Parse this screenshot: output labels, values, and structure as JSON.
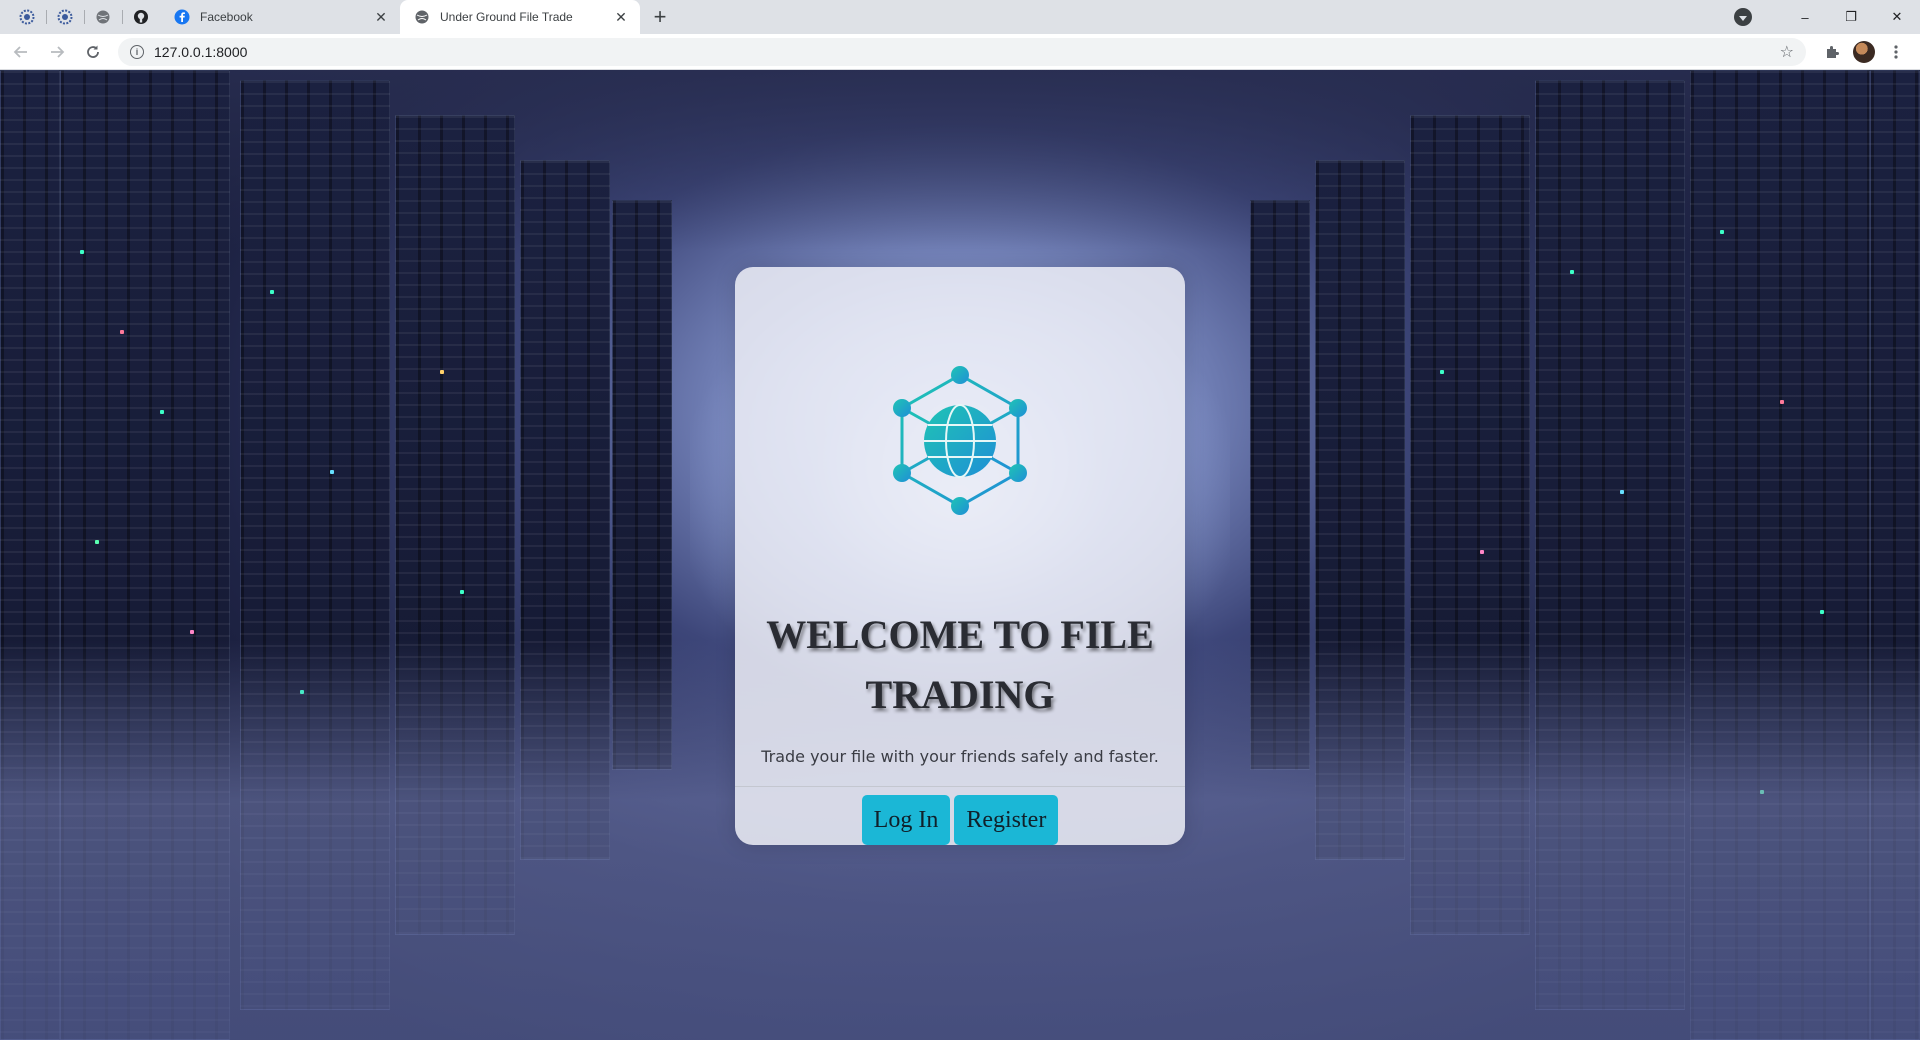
{
  "browser": {
    "tabs": [
      {
        "title": "Facebook",
        "favicon": "facebook-icon"
      },
      {
        "title": "Under Ground File Trade",
        "favicon": "globe-icon",
        "active": true
      }
    ],
    "pinned_tabs": [
      "settings-icon",
      "settings-icon",
      "globe-icon",
      "github-icon"
    ],
    "address": "127.0.0.1:8000",
    "window_controls": {
      "minimize": "–",
      "maximize": "❐",
      "close": "✕"
    }
  },
  "page": {
    "heading": "WELCOME TO FILE TRADING",
    "subtitle": "Trade your file with your friends safely and faster.",
    "login_label": "Log In",
    "register_label": "Register",
    "colors": {
      "button": "#1bb7d6",
      "logo_teal": "#1fc4b4",
      "logo_blue": "#1f8fd6"
    }
  }
}
